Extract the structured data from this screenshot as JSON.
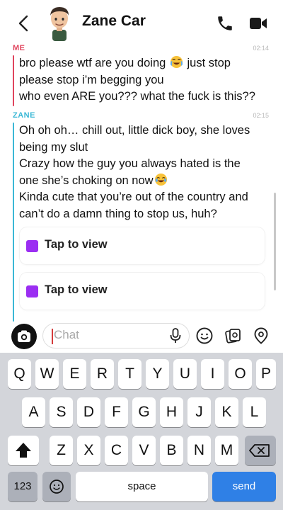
{
  "header": {
    "title": "Zane Car"
  },
  "messages": [
    {
      "sender": "ME",
      "sender_color": "#e0455e",
      "time": "02:14",
      "lines": [
        {
          "text": "bro please wtf are you doing ",
          "emoji": "crying-laughing",
          "after": " just stop"
        },
        {
          "text": "please stop i’m begging you"
        },
        {
          "text": "who even ARE you??? what the fuck is this??"
        }
      ]
    },
    {
      "sender": "ZANE",
      "sender_color": "#3bb8d6",
      "time": "02:15",
      "lines": [
        {
          "text": "Oh oh oh… chill out, little dick boy, she loves"
        },
        {
          "text": "being my slut"
        },
        {
          "text": "Crazy how the guy you always hated is the"
        },
        {
          "text": "one she’s choking on now",
          "emoji": "laughing-tears"
        },
        {
          "text": "Kinda cute that you’re out of the country and"
        },
        {
          "text": "can’t do a damn thing to stop us, huh?"
        }
      ],
      "snaps": [
        {
          "label": "Tap to view",
          "color": "#9b2ef2"
        },
        {
          "label": "Tap to view",
          "color": "#9b2ef2"
        }
      ]
    }
  ],
  "input": {
    "placeholder": "Chat"
  },
  "keyboard": {
    "row1": [
      "Q",
      "W",
      "E",
      "R",
      "T",
      "Y",
      "U",
      "I",
      "O",
      "P"
    ],
    "row2": [
      "A",
      "S",
      "D",
      "F",
      "G",
      "H",
      "J",
      "K",
      "L"
    ],
    "row3": [
      "Z",
      "X",
      "C",
      "V",
      "B",
      "N",
      "M"
    ],
    "numbers_label": "123",
    "space_label": "space",
    "send_label": "send",
    "send_color": "#2f80e6"
  }
}
